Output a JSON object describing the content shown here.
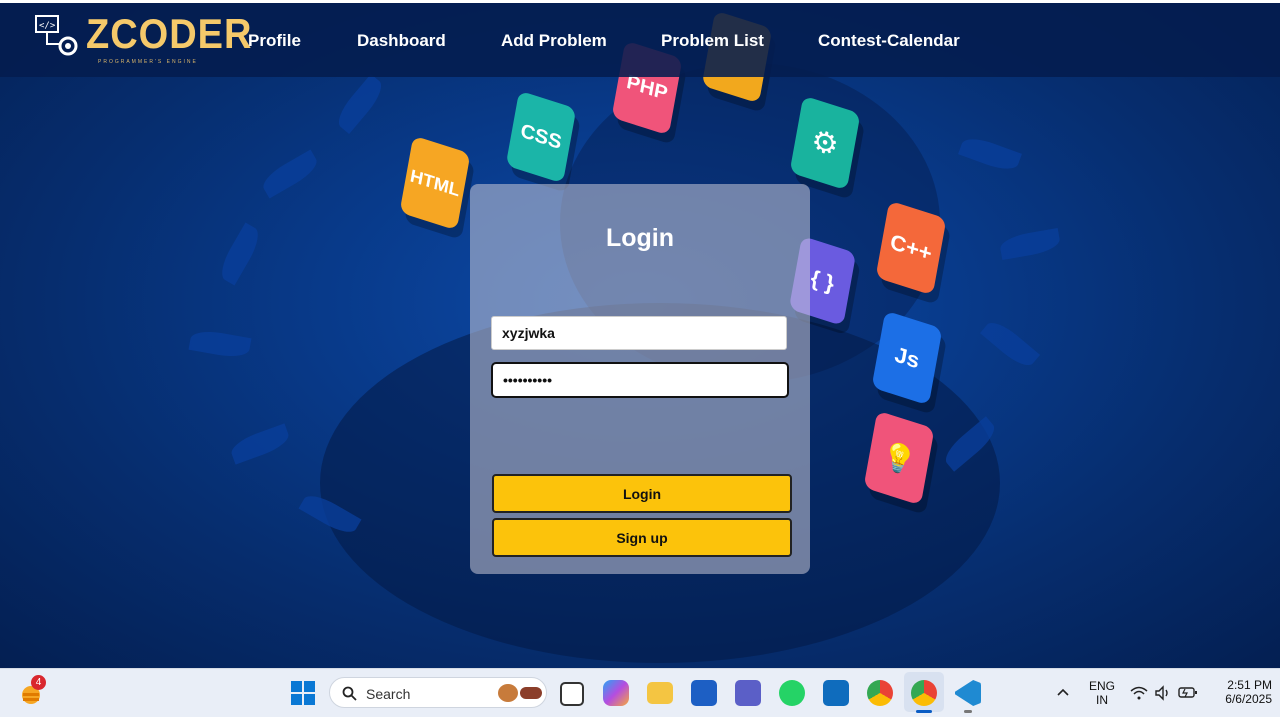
{
  "navbar": {
    "logo_text": "ZCODER",
    "logo_tagline": "PROGRAMMER'S ENGINE",
    "links": [
      "Profile",
      "Dashboard",
      "Add Problem",
      "Problem List",
      "Contest-Calendar"
    ]
  },
  "background_tiles": [
    "HTML",
    "CSS",
    "PHP",
    "C++",
    "Js",
    "{ }"
  ],
  "login": {
    "title": "Login",
    "username_value": "xyzjwka",
    "password_value": "••••••••••",
    "login_label": "Login",
    "signup_label": "Sign up"
  },
  "taskbar": {
    "weather_badge": "4",
    "search_placeholder": "Search",
    "apps": [
      "start-icon",
      "task-view-icon",
      "copilot-icon",
      "file-explorer-icon",
      "store-icon",
      "teams-icon",
      "whatsapp-icon",
      "outlook-icon",
      "chrome-icon",
      "chrome-active-icon",
      "vscode-icon"
    ],
    "language_line1": "ENG",
    "language_line2": "IN",
    "time": "2:51 PM",
    "date": "6/6/2025"
  },
  "colors": {
    "accent_button": "#fcc30b",
    "navbar_bg": "#041c4e",
    "logo_gold": "#f5c96a"
  }
}
